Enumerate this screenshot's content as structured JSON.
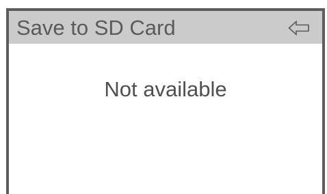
{
  "screen": {
    "title": "Save to SD Card",
    "message": "Not available",
    "back_icon": "back-arrow-icon"
  },
  "colors": {
    "frame_border": "#5d5d5d",
    "titlebar_bg": "#cbcbcb",
    "title_text": "#5a5a5a",
    "message_text": "#4f4f4f",
    "background": "#ffffff"
  }
}
